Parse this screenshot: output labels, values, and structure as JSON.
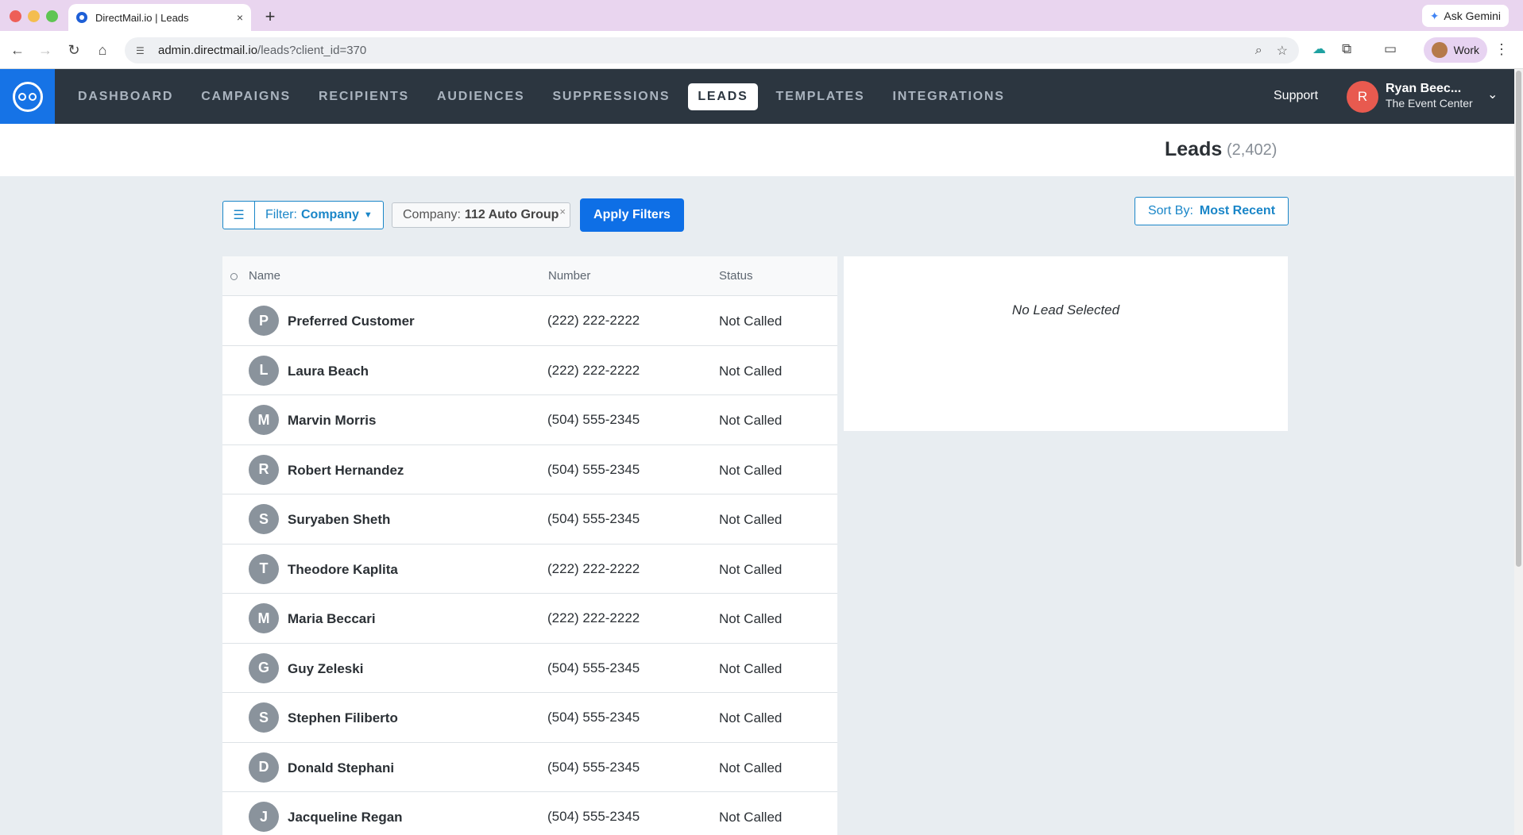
{
  "browser": {
    "tab_title": "DirectMail.io | Leads",
    "tab_close": "×",
    "new_tab": "+",
    "url_host": "admin.directmail.io",
    "url_path": "/leads?client_id=370",
    "gemini_label": "Ask Gemini",
    "profile_label": "Work"
  },
  "nav": {
    "items": [
      {
        "label": "DASHBOARD",
        "active": false
      },
      {
        "label": "CAMPAIGNS",
        "active": false
      },
      {
        "label": "RECIPIENTS",
        "active": false
      },
      {
        "label": "AUDIENCES",
        "active": false
      },
      {
        "label": "SUPPRESSIONS",
        "active": false
      },
      {
        "label": "LEADS",
        "active": true
      },
      {
        "label": "TEMPLATES",
        "active": false
      },
      {
        "label": "INTEGRATIONS",
        "active": false
      }
    ],
    "support_label": "Support"
  },
  "user": {
    "initial": "R",
    "name": "Ryan Beec...",
    "org": "The Event Center"
  },
  "page": {
    "title": "Leads",
    "count": "(2,402)"
  },
  "filters": {
    "filter_prefix": "Filter:",
    "filter_value": "Company",
    "chip_prefix": "Company:",
    "chip_value": "112 Auto Group",
    "chip_remove": "×",
    "apply_label": "Apply Filters",
    "sort_prefix": "Sort By:",
    "sort_value": "Most Recent"
  },
  "table": {
    "headers": {
      "name": "Name",
      "number": "Number",
      "status": "Status"
    },
    "rows": [
      {
        "initial": "P",
        "name": "Preferred Customer",
        "number": "(222) 222-2222",
        "status": "Not Called"
      },
      {
        "initial": "L",
        "name": "Laura Beach",
        "number": "(222) 222-2222",
        "status": "Not Called"
      },
      {
        "initial": "M",
        "name": "Marvin Morris",
        "number": "(504) 555-2345",
        "status": "Not Called"
      },
      {
        "initial": "R",
        "name": "Robert Hernandez",
        "number": "(504) 555-2345",
        "status": "Not Called"
      },
      {
        "initial": "S",
        "name": "Suryaben Sheth",
        "number": "(504) 555-2345",
        "status": "Not Called"
      },
      {
        "initial": "T",
        "name": "Theodore Kaplita",
        "number": "(222) 222-2222",
        "status": "Not Called"
      },
      {
        "initial": "M",
        "name": "Maria Beccari",
        "number": "(222) 222-2222",
        "status": "Not Called"
      },
      {
        "initial": "G",
        "name": "Guy Zeleski",
        "number": "(504) 555-2345",
        "status": "Not Called"
      },
      {
        "initial": "S",
        "name": "Stephen Filiberto",
        "number": "(504) 555-2345",
        "status": "Not Called"
      },
      {
        "initial": "D",
        "name": "Donald Stephani",
        "number": "(504) 555-2345",
        "status": "Not Called"
      },
      {
        "initial": "J",
        "name": "Jacqueline Regan",
        "number": "(504) 555-2345",
        "status": "Not Called"
      }
    ]
  },
  "detail": {
    "empty_message": "No Lead Selected"
  },
  "colors": {
    "header_bg": "#2c3640",
    "logo_bg": "#1673e6",
    "accent": "#1a86c8",
    "primary_button": "#0e6fe6",
    "user_avatar": "#e85a4f",
    "lead_avatar": "#8a939c"
  }
}
